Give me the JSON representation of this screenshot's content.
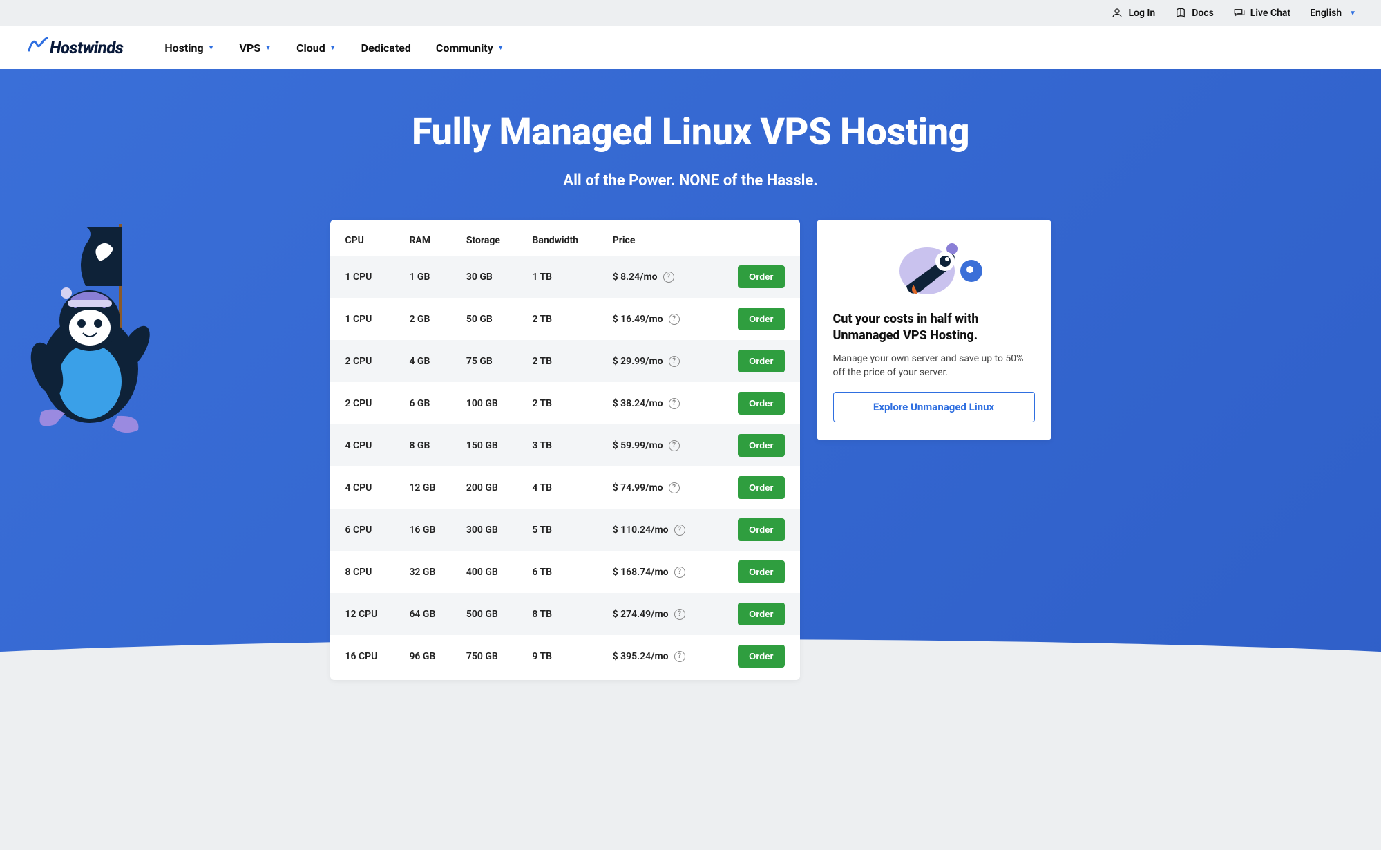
{
  "utilbar": {
    "login": "Log In",
    "docs": "Docs",
    "livechat": "Live Chat",
    "language": "English"
  },
  "brand": "Hostwinds",
  "nav": {
    "hosting": "Hosting",
    "vps": "VPS",
    "cloud": "Cloud",
    "dedicated": "Dedicated",
    "community": "Community"
  },
  "hero": {
    "title": "Fully Managed Linux VPS Hosting",
    "subtitle": "All of the Power. NONE of the Hassle."
  },
  "table": {
    "headers": {
      "cpu": "CPU",
      "ram": "RAM",
      "storage": "Storage",
      "bandwidth": "Bandwidth",
      "price": "Price"
    },
    "order_label": "Order",
    "rows": [
      {
        "cpu": "1 CPU",
        "ram": "1 GB",
        "storage": "30 GB",
        "bandwidth": "1 TB",
        "price": "$ 8.24/mo"
      },
      {
        "cpu": "1 CPU",
        "ram": "2 GB",
        "storage": "50 GB",
        "bandwidth": "2 TB",
        "price": "$ 16.49/mo"
      },
      {
        "cpu": "2 CPU",
        "ram": "4 GB",
        "storage": "75 GB",
        "bandwidth": "2 TB",
        "price": "$ 29.99/mo"
      },
      {
        "cpu": "2 CPU",
        "ram": "6 GB",
        "storage": "100 GB",
        "bandwidth": "2 TB",
        "price": "$ 38.24/mo"
      },
      {
        "cpu": "4 CPU",
        "ram": "8 GB",
        "storage": "150 GB",
        "bandwidth": "3 TB",
        "price": "$ 59.99/mo"
      },
      {
        "cpu": "4 CPU",
        "ram": "12 GB",
        "storage": "200 GB",
        "bandwidth": "4 TB",
        "price": "$ 74.99/mo"
      },
      {
        "cpu": "6 CPU",
        "ram": "16 GB",
        "storage": "300 GB",
        "bandwidth": "5 TB",
        "price": "$ 110.24/mo"
      },
      {
        "cpu": "8 CPU",
        "ram": "32 GB",
        "storage": "400 GB",
        "bandwidth": "6 TB",
        "price": "$ 168.74/mo"
      },
      {
        "cpu": "12 CPU",
        "ram": "64 GB",
        "storage": "500 GB",
        "bandwidth": "8 TB",
        "price": "$ 274.49/mo"
      },
      {
        "cpu": "16 CPU",
        "ram": "96 GB",
        "storage": "750 GB",
        "bandwidth": "9 TB",
        "price": "$ 395.24/mo"
      }
    ]
  },
  "sidebar": {
    "title": "Cut your costs in half with Unmanaged VPS Hosting.",
    "body": "Manage your own server and save up to 50% off the price of your server.",
    "cta": "Explore Unmanaged Linux"
  }
}
